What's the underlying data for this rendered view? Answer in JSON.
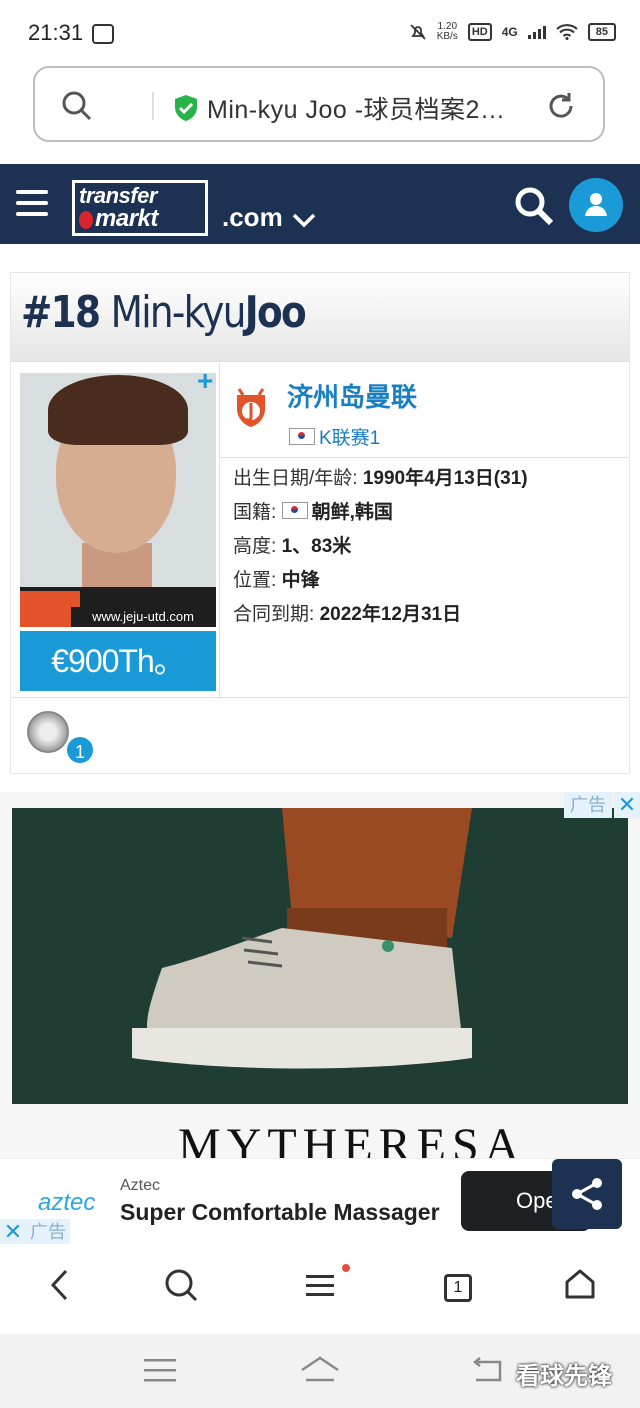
{
  "status_bar": {
    "time": "21:31",
    "net_speed_top": "1.20",
    "net_speed_bottom": "KB/s",
    "hd": "HD",
    "network": "4G",
    "battery": "85"
  },
  "browser": {
    "url_text": "Min-kyu  Joo  -球员档案2…"
  },
  "site": {
    "logo_line1": "transfer",
    "logo_line2": "markt",
    "domain": ".com"
  },
  "player": {
    "number": "#18",
    "first_name": "Min-kyu",
    "last_name": "Joo",
    "photo_credit": "www.jeju-utd.com",
    "market_value": "€900Th。",
    "club": "济州岛曼联",
    "league": "K联赛1",
    "info": [
      {
        "label": "出生日期/年龄: ",
        "value": "1990年4月13日(31)"
      },
      {
        "label": "国籍: ",
        "value": "朝鲜,韩国"
      },
      {
        "label": "高度: ",
        "value": "1、83米"
      },
      {
        "label": "位置: ",
        "value": "中锋"
      },
      {
        "label": "合同到期: ",
        "value": "2022年12月31日"
      }
    ],
    "trophy_count": "1",
    "plus": "+"
  },
  "ad": {
    "tag": "广告",
    "close": "✕",
    "brand": "MYTHERESA"
  },
  "bottom_ad": {
    "logo": "aztec",
    "sponsor": "Aztec",
    "title": "Super Comfortable Massager",
    "open": "Ope",
    "tag": "广告",
    "close": "✕"
  },
  "browser_nav": {
    "tabs_count": "1"
  },
  "watermark": "看球先锋"
}
